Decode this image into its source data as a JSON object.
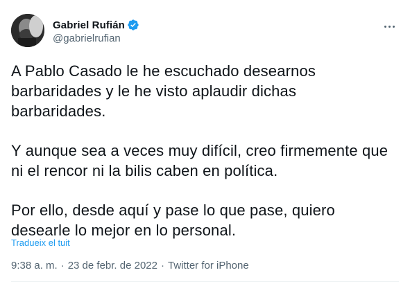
{
  "author": {
    "display_name": "Gabriel Rufián",
    "handle": "@gabrielrufian",
    "verified": true
  },
  "tweet": {
    "paragraphs": [
      [
        "A Pablo Casado le he escuchado desearnos",
        "barbaridades y le he visto aplaudir dichas",
        "barbaridades."
      ],
      [
        "Y aunque sea a veces muy difícil, creo firmemente que",
        "ni el rencor ni la bilis caben en política."
      ],
      [
        "Por ello, desde aquí y pase lo que pase, quiero",
        "desearle lo mejor en lo personal."
      ]
    ],
    "translate_link": "Tradueix el tuit"
  },
  "meta": {
    "time": "9:38 a. m.",
    "separator": "·",
    "date": "23 de febr. de 2022",
    "source": "Twitter for iPhone"
  },
  "colors": {
    "text": "#0f1419",
    "secondary": "#536471",
    "accent": "#1d9bf0"
  },
  "icons": {
    "verified": "verified-badge-icon",
    "more": "more-horizontal-icon"
  }
}
